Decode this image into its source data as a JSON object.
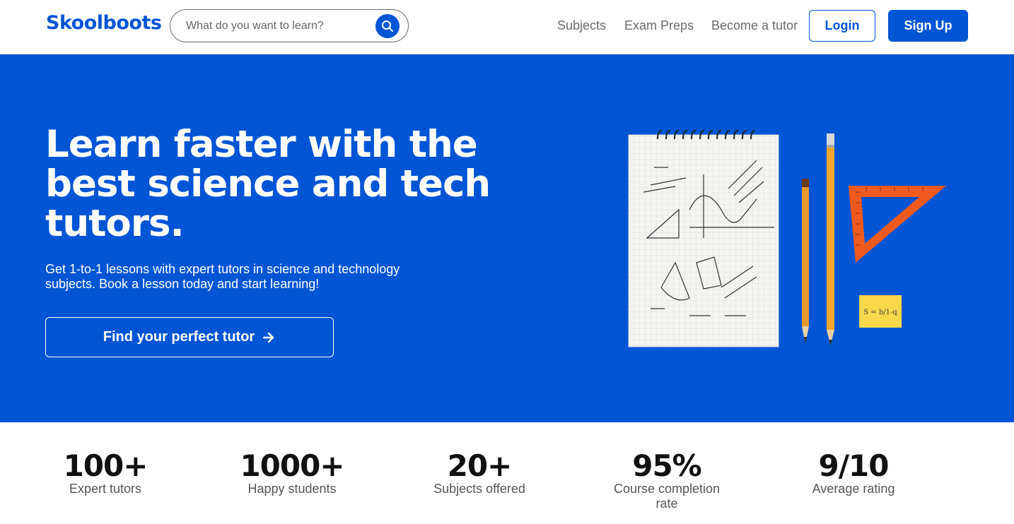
{
  "brand": {
    "name": "Skoolboots",
    "accent": "#0055d4"
  },
  "search": {
    "placeholder": "What do you want to learn?",
    "icon": "search-icon"
  },
  "nav": {
    "links": [
      "Subjects",
      "Exam Preps",
      "Become a tutor"
    ],
    "login_label": "Login",
    "signup_label": "Sign Up"
  },
  "hero": {
    "title": "Learn faster with the best science and tech tutors.",
    "subtitle": "Get 1-to-1 lessons with expert tutors in science and technology subjects. Book a lesson today and start learning!",
    "cta_label": "Find your perfect tutor",
    "cta_icon": "arrow-right-icon",
    "image": "notebook-pencils-ruler-illustration",
    "sticky_note_text": "S = b/1-q",
    "background": "#0055d4"
  },
  "stats": [
    {
      "value": "100+",
      "label": "Expert tutors"
    },
    {
      "value": "1000+",
      "label": "Happy students"
    },
    {
      "value": "20+",
      "label": "Subjects offered"
    },
    {
      "value": "95%",
      "label": "Course completion rate"
    },
    {
      "value": "9/10",
      "label": "Average rating"
    }
  ]
}
